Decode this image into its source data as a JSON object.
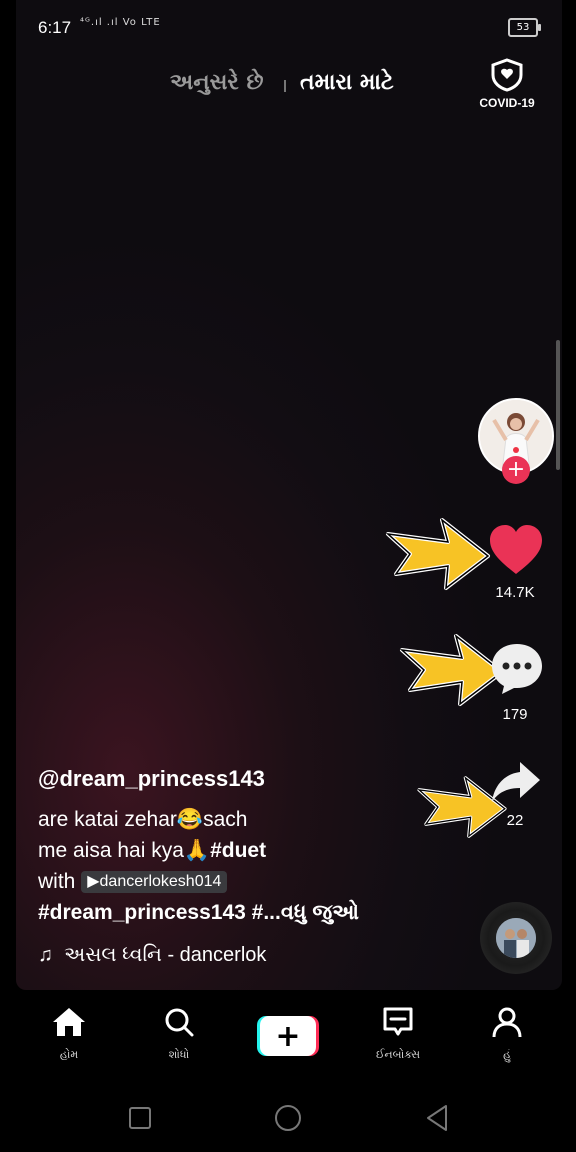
{
  "status": {
    "time": "6:17",
    "signal": "⁴ᴳ.ıl .ıl Vo LTE",
    "battery": "53"
  },
  "tabs": {
    "following": "અનુસરે છે",
    "for_you": "તમારા માટે"
  },
  "covid": {
    "label": "COVID-19"
  },
  "actions": {
    "likes": "14.7K",
    "comments": "179",
    "shares": "22"
  },
  "caption": {
    "username": "@dream_princess143",
    "line1_text": "are katai zehar",
    "line1_emoji": "😂",
    "line1_after": "sach",
    "line2_text": "me aisa hai kya",
    "line2_emoji": "🙏",
    "line2_tag": "#duet",
    "line3_text": "with",
    "mention": "dancerlokesh014",
    "line4_tag": "#dream_princess143 #...",
    "see_more": "વધુ જુઓ"
  },
  "music": {
    "icon": "♫",
    "text": "અસલ ધ્વનિ - dancerlok"
  },
  "nav": {
    "home": "હોમ",
    "search": "શોધો",
    "add": "+",
    "inbox": "ઈનબોક્સ",
    "me": "હું"
  },
  "colors": {
    "like": "#ea3356",
    "arrow": "#f7c325",
    "accent_cyan": "#25f4ee",
    "accent_red": "#fe2c55"
  },
  "icons": {
    "home": "home-icon",
    "search": "search-icon",
    "inbox": "inbox-icon",
    "profile": "profile-icon",
    "heart": "heart-icon",
    "comment": "comment-icon",
    "share": "share-icon",
    "shield": "shield-icon"
  }
}
